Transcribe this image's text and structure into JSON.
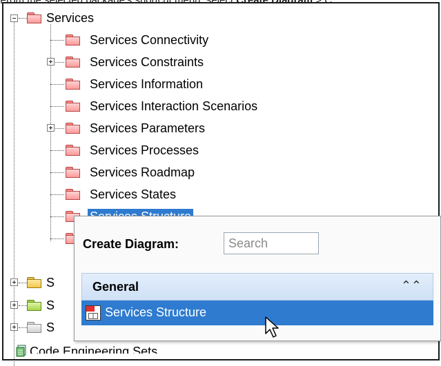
{
  "caption": {
    "prefix": "From the selected package's shortcut menu, select ",
    "emphasis": "Create Diagram",
    "suffix": " > C"
  },
  "tree": {
    "root": {
      "label": "Services",
      "folder_color": "red",
      "expanded": true
    },
    "children": [
      {
        "label": "Services Connectivity",
        "has_children": false
      },
      {
        "label": "Services Constraints",
        "has_children": true
      },
      {
        "label": "Services Information",
        "has_children": false
      },
      {
        "label": "Services Interaction Scenarios",
        "has_children": false
      },
      {
        "label": "Services Parameters",
        "has_children": true
      },
      {
        "label": "Services Processes",
        "has_children": false
      },
      {
        "label": "Services Roadmap",
        "has_children": false
      },
      {
        "label": "Services States",
        "has_children": false
      },
      {
        "label": "Services Structure",
        "has_children": false,
        "selected": true
      }
    ],
    "siblings": [
      {
        "label": "S",
        "folder_color": "yellow"
      },
      {
        "label": "S",
        "folder_color": "green"
      },
      {
        "label": "S",
        "folder_color": "gray"
      }
    ],
    "bottom_item": {
      "label": "Code Engineering Sets",
      "icon": "code-engineering-icon"
    }
  },
  "popup": {
    "title": "Create Diagram:",
    "search_placeholder": "Search",
    "category": {
      "label": "General",
      "icon": "double-chevron-up-icon"
    },
    "items": [
      {
        "label": "Services Structure",
        "icon": "services-structure-diagram-icon",
        "selected": true
      }
    ]
  },
  "colors": {
    "selection": "#2e7bd0",
    "category_bg": "#d8e7f8"
  }
}
